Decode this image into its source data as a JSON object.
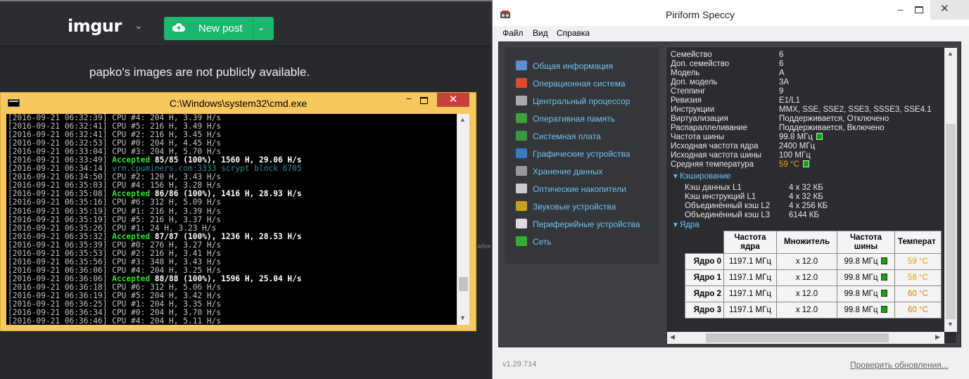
{
  "imgur": {
    "logo": "imgur",
    "new_post": "New post",
    "not_public": "papko's images are not publicly available.",
    "ad_fragment": "adve"
  },
  "cmd": {
    "title": "C:\\Windows\\system32\\cmd.exe",
    "lines": [
      {
        "ts": "[2016-09-21 06:32:39]",
        "kind": "cpu",
        "text": "CPU #4: 204 H, 3.39 H/s"
      },
      {
        "ts": "[2016-09-21 06:32:41]",
        "kind": "cpu",
        "text": "CPU #5: 216 H, 3.49 H/s"
      },
      {
        "ts": "[2016-09-21 06:32:41]",
        "kind": "cpu",
        "text": "CPU #2: 216 H, 3.45 H/s"
      },
      {
        "ts": "[2016-09-21 06:32:53]",
        "kind": "cpu",
        "text": "CPU #0: 204 H, 4.45 H/s"
      },
      {
        "ts": "[2016-09-21 06:33:04]",
        "kind": "cpu",
        "text": "CPU #3: 204 H, 5.70 H/s"
      },
      {
        "ts": "[2016-09-21 06:33:49]",
        "kind": "acc",
        "acc": "Accepted",
        "text": "85/85 (100%), 1560 H, 29.06 H/s"
      },
      {
        "ts": "[2016-09-21 06:34:14]",
        "kind": "blue",
        "text": "vrm.cpuminers.com:3333 scrypt block 6705"
      },
      {
        "ts": "[2016-09-21 06:34:50]",
        "kind": "cpu",
        "text": "CPU #2: 120 H, 3.43 H/s"
      },
      {
        "ts": "[2016-09-21 06:35:03]",
        "kind": "cpu",
        "text": "CPU #4: 156 H, 3.28 H/s"
      },
      {
        "ts": "[2016-09-21 06:35:08]",
        "kind": "acc",
        "acc": "Accepted",
        "text": "86/86 (100%), 1416 H, 28.93 H/s"
      },
      {
        "ts": "[2016-09-21 06:35:16]",
        "kind": "cpu",
        "text": "CPU #6: 312 H, 5.09 H/s"
      },
      {
        "ts": "[2016-09-21 06:35:19]",
        "kind": "cpu",
        "text": "CPU #1: 216 H, 3.39 H/s"
      },
      {
        "ts": "[2016-09-21 06:35:19]",
        "kind": "cpu",
        "text": "CPU #5: 216 H, 3.37 H/s"
      },
      {
        "ts": "[2016-09-21 06:35:26]",
        "kind": "cpu",
        "text": "CPU #1: 24 H, 3.23 H/s"
      },
      {
        "ts": "[2016-09-21 06:35:32]",
        "kind": "acc",
        "acc": "Accepted",
        "text": "87/87 (100%), 1236 H, 28.53 H/s"
      },
      {
        "ts": "[2016-09-21 06:35:39]",
        "kind": "cpu",
        "text": "CPU #0: 276 H, 3.27 H/s"
      },
      {
        "ts": "[2016-09-21 06:35:53]",
        "kind": "cpu",
        "text": "CPU #2: 216 H, 3.41 H/s"
      },
      {
        "ts": "[2016-09-21 06:35:56]",
        "kind": "cpu",
        "text": "CPU #3: 348 H, 3.43 H/s"
      },
      {
        "ts": "[2016-09-21 06:36:06]",
        "kind": "cpu",
        "text": "CPU #4: 204 H, 3.25 H/s"
      },
      {
        "ts": "[2016-09-21 06:36:06]",
        "kind": "acc",
        "acc": "Accepted",
        "text": "88/88 (100%), 1596 H, 25.04 H/s"
      },
      {
        "ts": "[2016-09-21 06:36:18]",
        "kind": "cpu",
        "text": "CPU #6: 312 H, 5.06 H/s"
      },
      {
        "ts": "[2016-09-21 06:36:19]",
        "kind": "cpu",
        "text": "CPU #5: 204 H, 3.42 H/s"
      },
      {
        "ts": "[2016-09-21 06:36:25]",
        "kind": "cpu",
        "text": "CPU #1: 204 H, 3.35 H/s"
      },
      {
        "ts": "[2016-09-21 06:36:34]",
        "kind": "cpu",
        "text": "CPU #0: 204 H, 3.70 H/s"
      },
      {
        "ts": "[2016-09-21 06:36:46]",
        "kind": "cpu",
        "text": "CPU #4: 204 H, 5.11 H/s"
      }
    ]
  },
  "speccy": {
    "title": "Piriform Speccy",
    "menu": [
      "Файл",
      "Вид",
      "Справка"
    ],
    "nav": [
      {
        "label": "Общая информация",
        "icon": "summary-icon",
        "color": "#5b8fd0"
      },
      {
        "label": "Операционная система",
        "icon": "windows-icon",
        "color": "#e04a2a"
      },
      {
        "label": "Центральный процессор",
        "icon": "cpu-icon",
        "color": "#aaaaaa"
      },
      {
        "label": "Оперативная память",
        "icon": "ram-icon",
        "color": "#3aa33a"
      },
      {
        "label": "Системная плата",
        "icon": "motherboard-icon",
        "color": "#3a9a3a"
      },
      {
        "label": "Графические устройства",
        "icon": "display-icon",
        "color": "#3a7ac0"
      },
      {
        "label": "Хранение данных",
        "icon": "hdd-icon",
        "color": "#999999"
      },
      {
        "label": "Оптические накопители",
        "icon": "disc-icon",
        "color": "#cccccc"
      },
      {
        "label": "Звуковые устройства",
        "icon": "speaker-icon",
        "color": "#c8a020"
      },
      {
        "label": "Периферийные устройства",
        "icon": "mouse-icon",
        "color": "#dddddd"
      },
      {
        "label": "Сеть",
        "icon": "network-icon",
        "color": "#30b030"
      }
    ],
    "props": [
      {
        "k": "Семейство",
        "v": "6"
      },
      {
        "k": "Доп. семейство",
        "v": "6"
      },
      {
        "k": "Модель",
        "v": "A"
      },
      {
        "k": "Доп. модель",
        "v": "3A"
      },
      {
        "k": "Степпинг",
        "v": "9"
      },
      {
        "k": "Ревизия",
        "v": "E1/L1"
      },
      {
        "k": "Инструкции",
        "v": "MMX, SSE, SSE2, SSE3, SSSE3, SSE4.1"
      },
      {
        "k": "Виртуализация",
        "v": "Поддерживается, Отключено"
      },
      {
        "k": "Распараллеливание",
        "v": "Поддерживается, Включено"
      },
      {
        "k": "Частота шины",
        "v": "99.8 МГц"
      },
      {
        "k": "Исходная частота ядра",
        "v": "2400 МГц"
      },
      {
        "k": "Исходная частота шины",
        "v": "100 МГц"
      },
      {
        "k": "Средняя температура",
        "v": "59 °C"
      }
    ],
    "cache_title": "Кэширование",
    "cache": [
      {
        "k": "Кэш данных L1",
        "v": "4 x 32 КБ"
      },
      {
        "k": "Кэш инструкций L1",
        "v": "4 x 32 КБ"
      },
      {
        "k": "Объединённый кэш L2",
        "v": "4 x 256 КБ"
      },
      {
        "k": "Объединённый кэш L3",
        "v": "6144 КБ"
      }
    ],
    "cores_title": "Ядра",
    "table_headers": [
      "Частота ядра",
      "Множитель",
      "Частота шины",
      "Температ"
    ],
    "cores": [
      {
        "name": "Ядро 0",
        "freq": "1197.1 МГц",
        "mult": "x 12.0",
        "bus": "99.8 МГц",
        "temp": "59 °C",
        "tone": "amber"
      },
      {
        "name": "Ядро 1",
        "freq": "1197.1 МГц",
        "mult": "x 12.0",
        "bus": "99.8 МГц",
        "temp": "58 °C",
        "tone": "amber"
      },
      {
        "name": "Ядро 2",
        "freq": "1197.1 МГц",
        "mult": "x 12.0",
        "bus": "99.8 МГц",
        "temp": "60 °C",
        "tone": "orange"
      },
      {
        "name": "Ядро 3",
        "freq": "1197.1 МГц",
        "mult": "x 12.0",
        "bus": "99.8 МГц",
        "temp": "60 °C",
        "tone": "orange"
      }
    ],
    "version": "v1.29.714",
    "update_link": "Проверить обновления..."
  }
}
